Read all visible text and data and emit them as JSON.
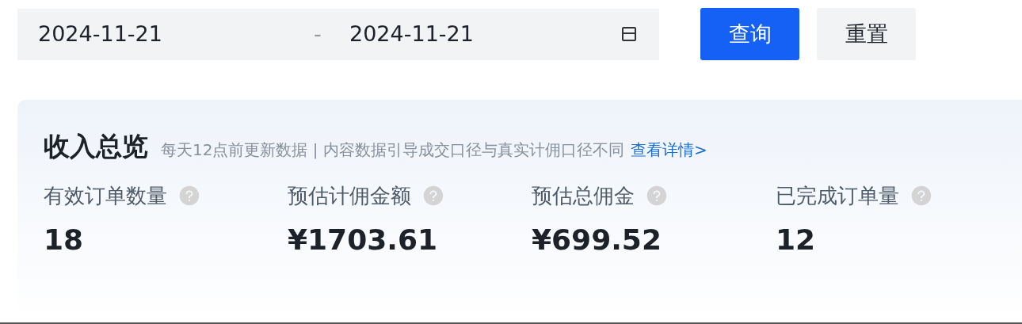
{
  "date_range": {
    "start": "2024-11-21",
    "separator": "-",
    "end": "2024-11-21"
  },
  "buttons": [
    {
      "label": "查询",
      "kind": "primary"
    },
    {
      "label": "重置",
      "kind": "secondary"
    }
  ],
  "overview": {
    "title": "收入总览",
    "note": "每天12点前更新数据 | 内容数据引导成交口径与真实计佣口径不同",
    "link": "查看详情>",
    "metrics": [
      {
        "label": "有效订单数量",
        "value": "18"
      },
      {
        "label": "预估计佣金额",
        "value": "¥1703.61"
      },
      {
        "label": "预估总佣金",
        "value": "¥699.52"
      },
      {
        "label": "已完成订单量",
        "value": "12"
      }
    ]
  }
}
